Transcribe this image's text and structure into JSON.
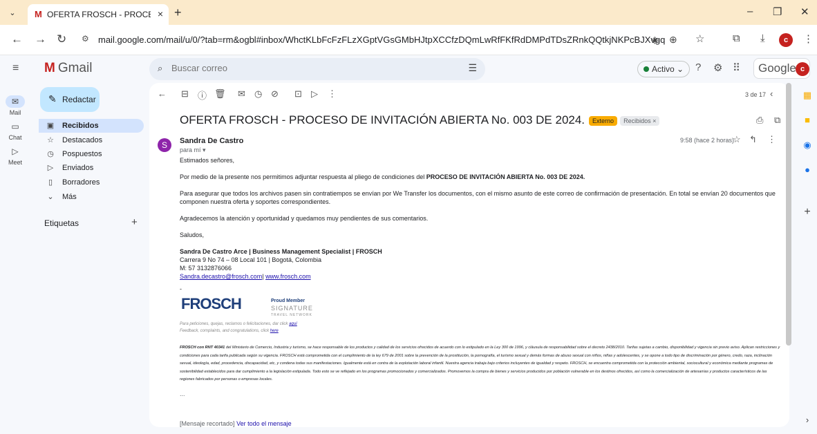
{
  "browser": {
    "tab_title": "OFERTA FROSCH - PROCESO DE",
    "tab_close": "×",
    "new_tab": "+",
    "url": "mail.google.com/mail/u/0/?tab=rm&ogbl#inbox/WhctKLbFcFzFLzXGptVGsGMbHJtpXCCfzDQmLwRfFKfRdDMPdTDsZRnkQQtkjNKPcBJXvgq",
    "profile_initial": "c",
    "colors": {
      "tabstrip": "#fbeacb",
      "accent": "#c5221f"
    }
  },
  "gmail": {
    "logo_text": "Gmail",
    "search_placeholder": "Buscar correo",
    "status_label": "Activo",
    "google_label": "Google",
    "profile_initial": "c"
  },
  "rail": [
    {
      "label": "Mail",
      "icon": "mail-icon"
    },
    {
      "label": "Chat",
      "icon": "chat-icon"
    },
    {
      "label": "Meet",
      "icon": "meet-icon"
    }
  ],
  "sidebar": {
    "compose_label": "Redactar",
    "items": [
      {
        "label": "Recibidos",
        "icon": "inbox-icon",
        "selected": true
      },
      {
        "label": "Destacados",
        "icon": "star-icon"
      },
      {
        "label": "Pospuestos",
        "icon": "clock-icon"
      },
      {
        "label": "Enviados",
        "icon": "send-icon"
      },
      {
        "label": "Borradores",
        "icon": "draft-icon"
      },
      {
        "label": "Más",
        "icon": "chevron-down-icon"
      }
    ],
    "labels_heading": "Etiquetas",
    "labels_add": "+"
  },
  "toolbar": {
    "counter": "3 de 17"
  },
  "email": {
    "subject": "OFERTA FROSCH - PROCESO DE INVITACIÓN ABIERTA No. 003 DE 2024.",
    "tag_external": "Externo",
    "tag_inbox": "Recibidos ×",
    "avatar_initial": "S",
    "sender": "Sandra De Castro",
    "to": "para mí ▾",
    "time": "9:58 (hace 2 horas)",
    "greeting": "Estimados señores,",
    "p1_pre": "Por medio de la presente nos permitimos adjuntar respuesta al pliego de condiciones del ",
    "p1_bold": "PROCESO DE INVITACIÓN ABIERTA No. 003 DE 2024.",
    "p2": "Para asegurar que todos los archivos pasen sin contratiempos se envían por We Transfer los documentos, con el mismo asunto de este correo de confirmación de presentación. En total se envían 20 documentos que componen nuestra oferta y soportes correspondientes.",
    "p3": "Agradecemos la atención y oportunidad y quedamos muy pendientes de sus comentarios.",
    "closing": "Saludos,",
    "sig_name": "Sandra De Castro Arce | Business Management Specialist | FROSCH",
    "sig_address": "Carrera 9 No 74 – 08 Local 101 | Bogotá, Colombia",
    "sig_phone": "M: 57 3132876066",
    "sig_email": "Sandra.decastro@frosch.com",
    "sig_sep": "|",
    "sig_web": "www.frosch.com",
    "sig_dash": "-",
    "logo_text": "FROSCH",
    "proud_member": "Proud Member",
    "signature_network": "SIGNATURE",
    "signature_network2": "TRAVEL NETWORK",
    "note_es_pre": "Para peticiones, quejas, reclamos o felicitaciones, dar click ",
    "note_es_link": "aquí",
    "note_en_pre": "Feedback, complaints, and congratulations, click ",
    "note_en_link": "here",
    "legal_bold": "FROSCH con RNT 40341",
    "legal": " del Ministerio de Comercio, Industria y turismo, se hace responsable de los productos y calidad de los servicios ofrecidos de acuerdo con lo estipulado en la Ley 300 de 1996, y cláusula de responsabilidad sobre el decreto 2438/2010. Tarifas sujetas a cambio, disponibilidad y vigencia sin previo aviso. Aplican restricciones y condiciones para cada tarifa publicada según su vigencia. FROSCH está comprometida con el cumplimiento de la ley 679 de 2001 sobre la prevención de la prostitución, la pornografía, el turismo sexual y demás formas de abuso sexual con niños, niñas y adolescentes, y se opone a todo tipo de discriminación por género, credo, raza, inclinación sexual, ideología, edad, procedencia, discapacidad, etc, y condena todas sus manifestaciones. Igualmente está en contra de la explotación laboral infantil. Nuestra agencia trabaja bajo criterios incluyentes de igualdad y respeto. FROSCH, se encuentra comprometida con la protección ambiental, sociocultural y económica mediante programas de sostenibilidad establecidos para dar cumplimiento a la legislación estipulada. Todo esto se ve reflejado en los programas promocionados y comercializados. Promovemos la compra de bienes y servicios producidos por población vulnerable en los destinos ofrecidos, así como la comercialización de artesanías y productos característicos de las regiones fabricados por personas o empresas locales.",
    "ellipsis": "...",
    "trimmed": "[Mensaje recortado]",
    "view_all": "Ver todo el mensaje"
  }
}
